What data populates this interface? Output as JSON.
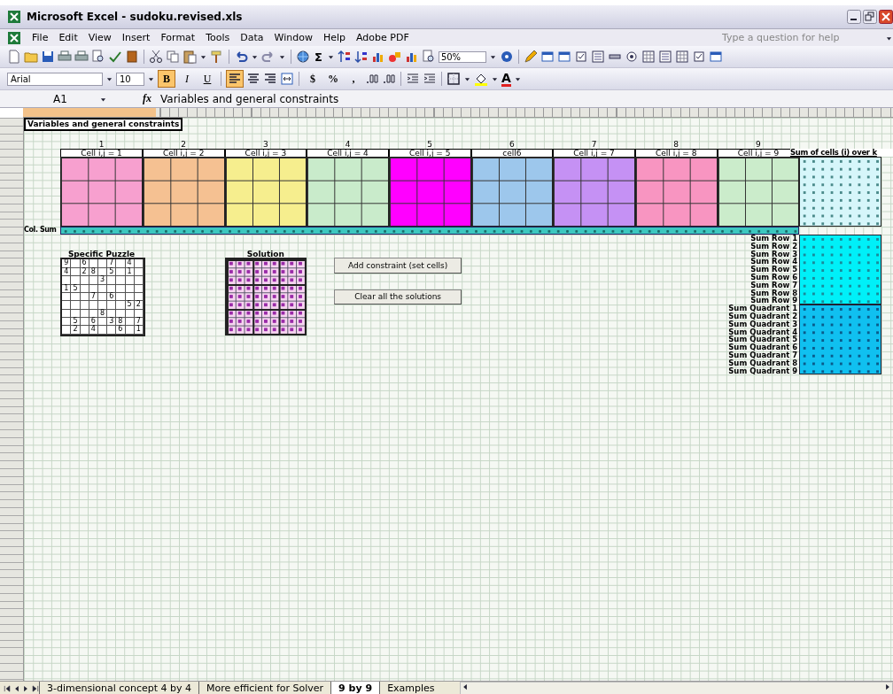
{
  "window": {
    "title": "Microsoft Excel - sudoku.revised.xls"
  },
  "menu": [
    "File",
    "Edit",
    "View",
    "Insert",
    "Format",
    "Tools",
    "Data",
    "Window",
    "Help",
    "Adobe PDF"
  ],
  "help_box": {
    "placeholder": "Type a question for help"
  },
  "standard_toolbar": {
    "sum": "Σ",
    "zoom": "50%"
  },
  "formatting_toolbar": {
    "font": "Arial",
    "size": "10",
    "bold": {
      "label": "B",
      "pressed": true
    },
    "italic": {
      "label": "I",
      "pressed": false
    },
    "underline": {
      "label": "U",
      "pressed": false
    },
    "align_left": {
      "pressed": true
    },
    "currency": "$",
    "percent": "%",
    "comma": ",",
    "font_color": "A"
  },
  "formula_bar": {
    "name_box": "A1",
    "function_label": "fx",
    "formula": "Variables and general constraints"
  },
  "sheet": {
    "a1": "Variables and general constraints",
    "blocks": [
      {
        "number": "1",
        "label": "Cell i,j = 1",
        "color": "#f7a0cf"
      },
      {
        "number": "2",
        "label": "Cell i,j = 2",
        "color": "#f5c192"
      },
      {
        "number": "3",
        "label": "Cell i,j = 3",
        "color": "#f6ee8e"
      },
      {
        "number": "4",
        "label": "Cell i,j = 4",
        "color": "#c9ebcb"
      },
      {
        "number": "5",
        "label": "Cell i,j = 5",
        "color": "#ff00ff"
      },
      {
        "number": "6",
        "label": "cell6",
        "color": "#9dc7ec"
      },
      {
        "number": "7",
        "label": "Cell i,j = 7",
        "color": "#c591f4"
      },
      {
        "number": "8",
        "label": "Cell i,j = 8",
        "color": "#f895c1"
      },
      {
        "number": "9",
        "label": "Cell i,j = 9",
        "color": "#cbeccb"
      }
    ],
    "sum_over_k": "Sum of cells (i) over k",
    "col_sum": "Col. Sum",
    "puzzle": {
      "title": "Specific Puzzle",
      "rows": [
        [
          "9",
          null,
          "6",
          null,
          null,
          "7",
          null,
          "4",
          null
        ],
        [
          "4",
          null,
          "2",
          "8",
          null,
          "5",
          null,
          "1",
          null
        ],
        [
          null,
          null,
          null,
          null,
          "3",
          null,
          null,
          null,
          null
        ],
        [
          "1",
          "5",
          null,
          null,
          null,
          null,
          null,
          null,
          null
        ],
        [
          null,
          null,
          null,
          "7",
          null,
          "6",
          null,
          null,
          null
        ],
        [
          null,
          null,
          null,
          null,
          null,
          null,
          null,
          "5",
          "2"
        ],
        [
          null,
          null,
          null,
          null,
          "8",
          null,
          null,
          null,
          null
        ],
        [
          null,
          "5",
          null,
          "6",
          null,
          "3",
          "8",
          null,
          "7"
        ],
        [
          null,
          "2",
          null,
          "4",
          null,
          null,
          "6",
          null,
          "1"
        ]
      ]
    },
    "solution": {
      "title": "Solution"
    },
    "buttons": [
      "Add constraint (set cells)",
      "Clear all the solutions"
    ],
    "row_sums": [
      "Sum Row 1",
      "Sum Row 2",
      "Sum Row 3",
      "Sum Row 4",
      "Sum Row 5",
      "Sum Row 6",
      "Sum Row 7",
      "Sum Row 8",
      "Sum Row 9"
    ],
    "quadrant_sums": [
      "Sum Quadrant 1",
      "Sum Quadrant 2",
      "Sum Quadrant 3",
      "Sum Quadrant 4",
      "Sum Quadrant 5",
      "Sum Quadrant 6",
      "Sum Quadrant 7",
      "Sum Quadrant 8",
      "Sum Quadrant 9"
    ]
  },
  "sheet_tabs": [
    {
      "label": "3-dimensional concept 4 by 4",
      "selected": false
    },
    {
      "label": "More efficient for Solver",
      "selected": false
    },
    {
      "label": "9 by 9",
      "selected": true
    },
    {
      "label": "Examples",
      "selected": false
    }
  ]
}
